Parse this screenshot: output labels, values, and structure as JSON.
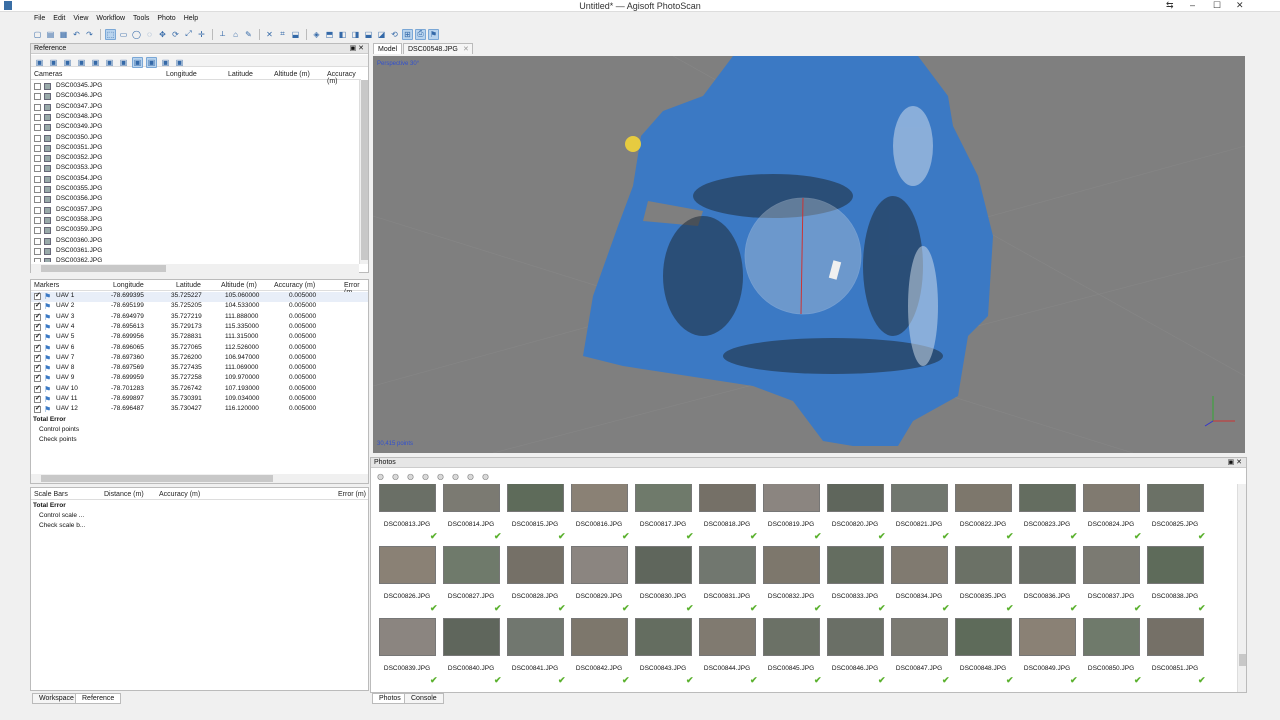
{
  "window": {
    "title": "Untitled* — Agisoft PhotoScan"
  },
  "menu": [
    "File",
    "Edit",
    "View",
    "Workflow",
    "Tools",
    "Photo",
    "Help"
  ],
  "toolbar_icons": [
    "new-icon",
    "open-icon",
    "save-icon",
    "undo-icon",
    "redo-icon",
    "navigation-icon",
    "rect-select-icon",
    "circle-select-icon",
    "free-select-icon",
    "move-region-icon",
    "rotate-region-icon",
    "resize-region-icon",
    "move-object-icon",
    "ruler-icon",
    "shape-icon",
    "brush-icon",
    "delete-icon",
    "crop-icon",
    "region-icon",
    "view-icon",
    "top-view-icon",
    "left-view-icon",
    "front-view-icon",
    "bottom-view-icon",
    "back-view-icon",
    "reset-view-icon",
    "model-view-icon",
    "camera-icon",
    "marker-icon"
  ],
  "reference": {
    "title": "Reference",
    "cameras": {
      "headers": [
        "Cameras",
        "Longitude",
        "Latitude",
        "Altitude (m)",
        "Accuracy (m)"
      ],
      "items": [
        "DSC00345.JPG",
        "DSC00346.JPG",
        "DSC00347.JPG",
        "DSC00348.JPG",
        "DSC00349.JPG",
        "DSC00350.JPG",
        "DSC00351.JPG",
        "DSC00352.JPG",
        "DSC00353.JPG",
        "DSC00354.JPG",
        "DSC00355.JPG",
        "DSC00356.JPG",
        "DSC00357.JPG",
        "DSC00358.JPG",
        "DSC00359.JPG",
        "DSC00360.JPG",
        "DSC00361.JPG",
        "DSC00362.JPG"
      ]
    },
    "markers": {
      "headers": [
        "Markers",
        "Longitude",
        "Latitude",
        "Altitude (m)",
        "Accuracy (m)",
        "Error (m"
      ],
      "rows": [
        {
          "name": "UAV 1",
          "lon": "-78.699395",
          "lat": "35.725227",
          "alt": "105.060000",
          "acc": "0.005000"
        },
        {
          "name": "UAV 2",
          "lon": "-78.695199",
          "lat": "35.725205",
          "alt": "104.533000",
          "acc": "0.005000"
        },
        {
          "name": "UAV 3",
          "lon": "-78.694979",
          "lat": "35.727219",
          "alt": "111.888000",
          "acc": "0.005000"
        },
        {
          "name": "UAV 4",
          "lon": "-78.695613",
          "lat": "35.729173",
          "alt": "115.335000",
          "acc": "0.005000"
        },
        {
          "name": "UAV 5",
          "lon": "-78.699956",
          "lat": "35.728831",
          "alt": "111.315000",
          "acc": "0.005000"
        },
        {
          "name": "UAV 6",
          "lon": "-78.696065",
          "lat": "35.727065",
          "alt": "112.526000",
          "acc": "0.005000"
        },
        {
          "name": "UAV 7",
          "lon": "-78.697360",
          "lat": "35.726200",
          "alt": "106.947000",
          "acc": "0.005000"
        },
        {
          "name": "UAV 8",
          "lon": "-78.697569",
          "lat": "35.727435",
          "alt": "111.069000",
          "acc": "0.005000"
        },
        {
          "name": "UAV 9",
          "lon": "-78.699959",
          "lat": "35.727258",
          "alt": "109.970000",
          "acc": "0.005000"
        },
        {
          "name": "UAV 10",
          "lon": "-78.701283",
          "lat": "35.726742",
          "alt": "107.193000",
          "acc": "0.005000"
        },
        {
          "name": "UAV 11",
          "lon": "-78.699897",
          "lat": "35.730391",
          "alt": "109.034000",
          "acc": "0.005000"
        },
        {
          "name": "UAV 12",
          "lon": "-78.696487",
          "lat": "35.730427",
          "alt": "116.120000",
          "acc": "0.005000"
        }
      ],
      "total": "Total Error",
      "control": "Control points",
      "check": "Check points"
    },
    "scalebars": {
      "headers": [
        "Scale Bars",
        "Distance (m)",
        "Accuracy (m)",
        "Error (m)"
      ],
      "total": "Total Error",
      "control": "Control scale ...",
      "check": "Check scale b..."
    },
    "bottom_tabs": [
      "Workspace",
      "Reference"
    ]
  },
  "model": {
    "tabs": [
      "Model",
      "DSC00548.JPG"
    ],
    "perspective": "Perspective 30°",
    "points": "30,415 points"
  },
  "photos": {
    "title": "Photos",
    "rows": [
      [
        "DSC00813.JPG",
        "DSC00814.JPG",
        "DSC00815.JPG",
        "DSC00816.JPG",
        "DSC00817.JPG",
        "DSC00818.JPG",
        "DSC00819.JPG",
        "DSC00820.JPG",
        "DSC00821.JPG",
        "DSC00822.JPG",
        "DSC00823.JPG",
        "DSC00824.JPG",
        "DSC00825.JPG"
      ],
      [
        "DSC00826.JPG",
        "DSC00827.JPG",
        "DSC00828.JPG",
        "DSC00829.JPG",
        "DSC00830.JPG",
        "DSC00831.JPG",
        "DSC00832.JPG",
        "DSC00833.JPG",
        "DSC00834.JPG",
        "DSC00835.JPG",
        "DSC00836.JPG",
        "DSC00837.JPG",
        "DSC00838.JPG"
      ],
      [
        "DSC00839.JPG",
        "DSC00840.JPG",
        "DSC00841.JPG",
        "DSC00842.JPG",
        "DSC00843.JPG",
        "DSC00844.JPG",
        "DSC00845.JPG",
        "DSC00846.JPG",
        "DSC00847.JPG",
        "DSC00848.JPG",
        "DSC00849.JPG",
        "DSC00850.JPG",
        "DSC00851.JPG"
      ]
    ],
    "bottom_tabs": [
      "Photos",
      "Console"
    ]
  },
  "colors": {
    "model_blue": "#3b79c4",
    "viewport_bg": "#7f7f7f",
    "check_green": "#5bb12f"
  }
}
